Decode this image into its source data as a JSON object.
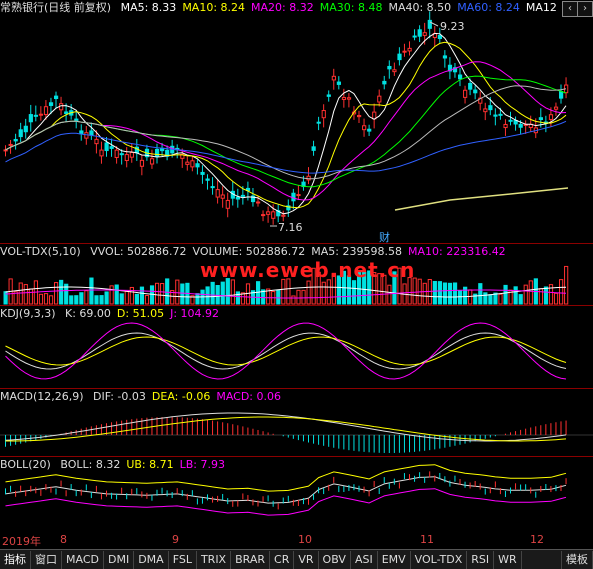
{
  "main_panel": {
    "title": "常熟银行(日线 前复权)",
    "indicators": [
      {
        "label": "MA5: 8.33",
        "color": "#ffffff"
      },
      {
        "label": "MA10: 8.24",
        "color": "#ffff00"
      },
      {
        "label": "MA20: 8.32",
        "color": "#ff00ff"
      },
      {
        "label": "MA30: 8.48",
        "color": "#00ff00"
      },
      {
        "label": "MA40: 8.50",
        "color": "#dddddd"
      },
      {
        "label": "MA60: 8.24",
        "color": "#3060ff"
      },
      {
        "label": "MA12",
        "color": "#ffffff"
      }
    ],
    "high_label": "9.23",
    "low_label": "7.16",
    "marker_label": "财"
  },
  "vol_panel": {
    "title": "VOL-TDX(5,10)",
    "indicators": [
      {
        "label": "VVOL: 502886.72",
        "color": "#dddddd"
      },
      {
        "label": "VOLUME: 502886.72",
        "color": "#dddddd"
      },
      {
        "label": "MA5: 239598.58",
        "color": "#dddddd"
      },
      {
        "label": "MA10: 223316.42",
        "color": "#ff00ff"
      }
    ]
  },
  "kdj_panel": {
    "title": "KDJ(9,3,3)",
    "indicators": [
      {
        "label": "K: 69.00",
        "color": "#dddddd"
      },
      {
        "label": "D: 51.05",
        "color": "#ffff00"
      },
      {
        "label": "J: 104.92",
        "color": "#ff00ff"
      }
    ]
  },
  "macd_panel": {
    "title": "MACD(12,26,9)",
    "indicators": [
      {
        "label": "DIF: -0.03",
        "color": "#dddddd"
      },
      {
        "label": "DEA: -0.06",
        "color": "#ffff00"
      },
      {
        "label": "MACD: 0.06",
        "color": "#ff00ff"
      }
    ]
  },
  "boll_panel": {
    "title": "BOLL(20)",
    "indicators": [
      {
        "label": "BOLL: 8.32",
        "color": "#dddddd"
      },
      {
        "label": "UB: 8.71",
        "color": "#ffff00"
      },
      {
        "label": "LB: 7.93",
        "color": "#ff00ff"
      }
    ]
  },
  "x_axis": {
    "labels": [
      "2019年",
      "8",
      "9",
      "10",
      "11",
      "12"
    ]
  },
  "watermark": "www.eweb.net.cn",
  "tabs": [
    "指标",
    "窗口",
    "MACD",
    "DMI",
    "DMA",
    "FSL",
    "TRIX",
    "BRAR",
    "CR",
    "VR",
    "OBV",
    "ASI",
    "EMV",
    "VOL-TDX",
    "RSI",
    "WR",
    "模板"
  ],
  "colors": {
    "up": "#ff3030",
    "down": "#00e0e0",
    "separator": "#8b0000"
  }
}
